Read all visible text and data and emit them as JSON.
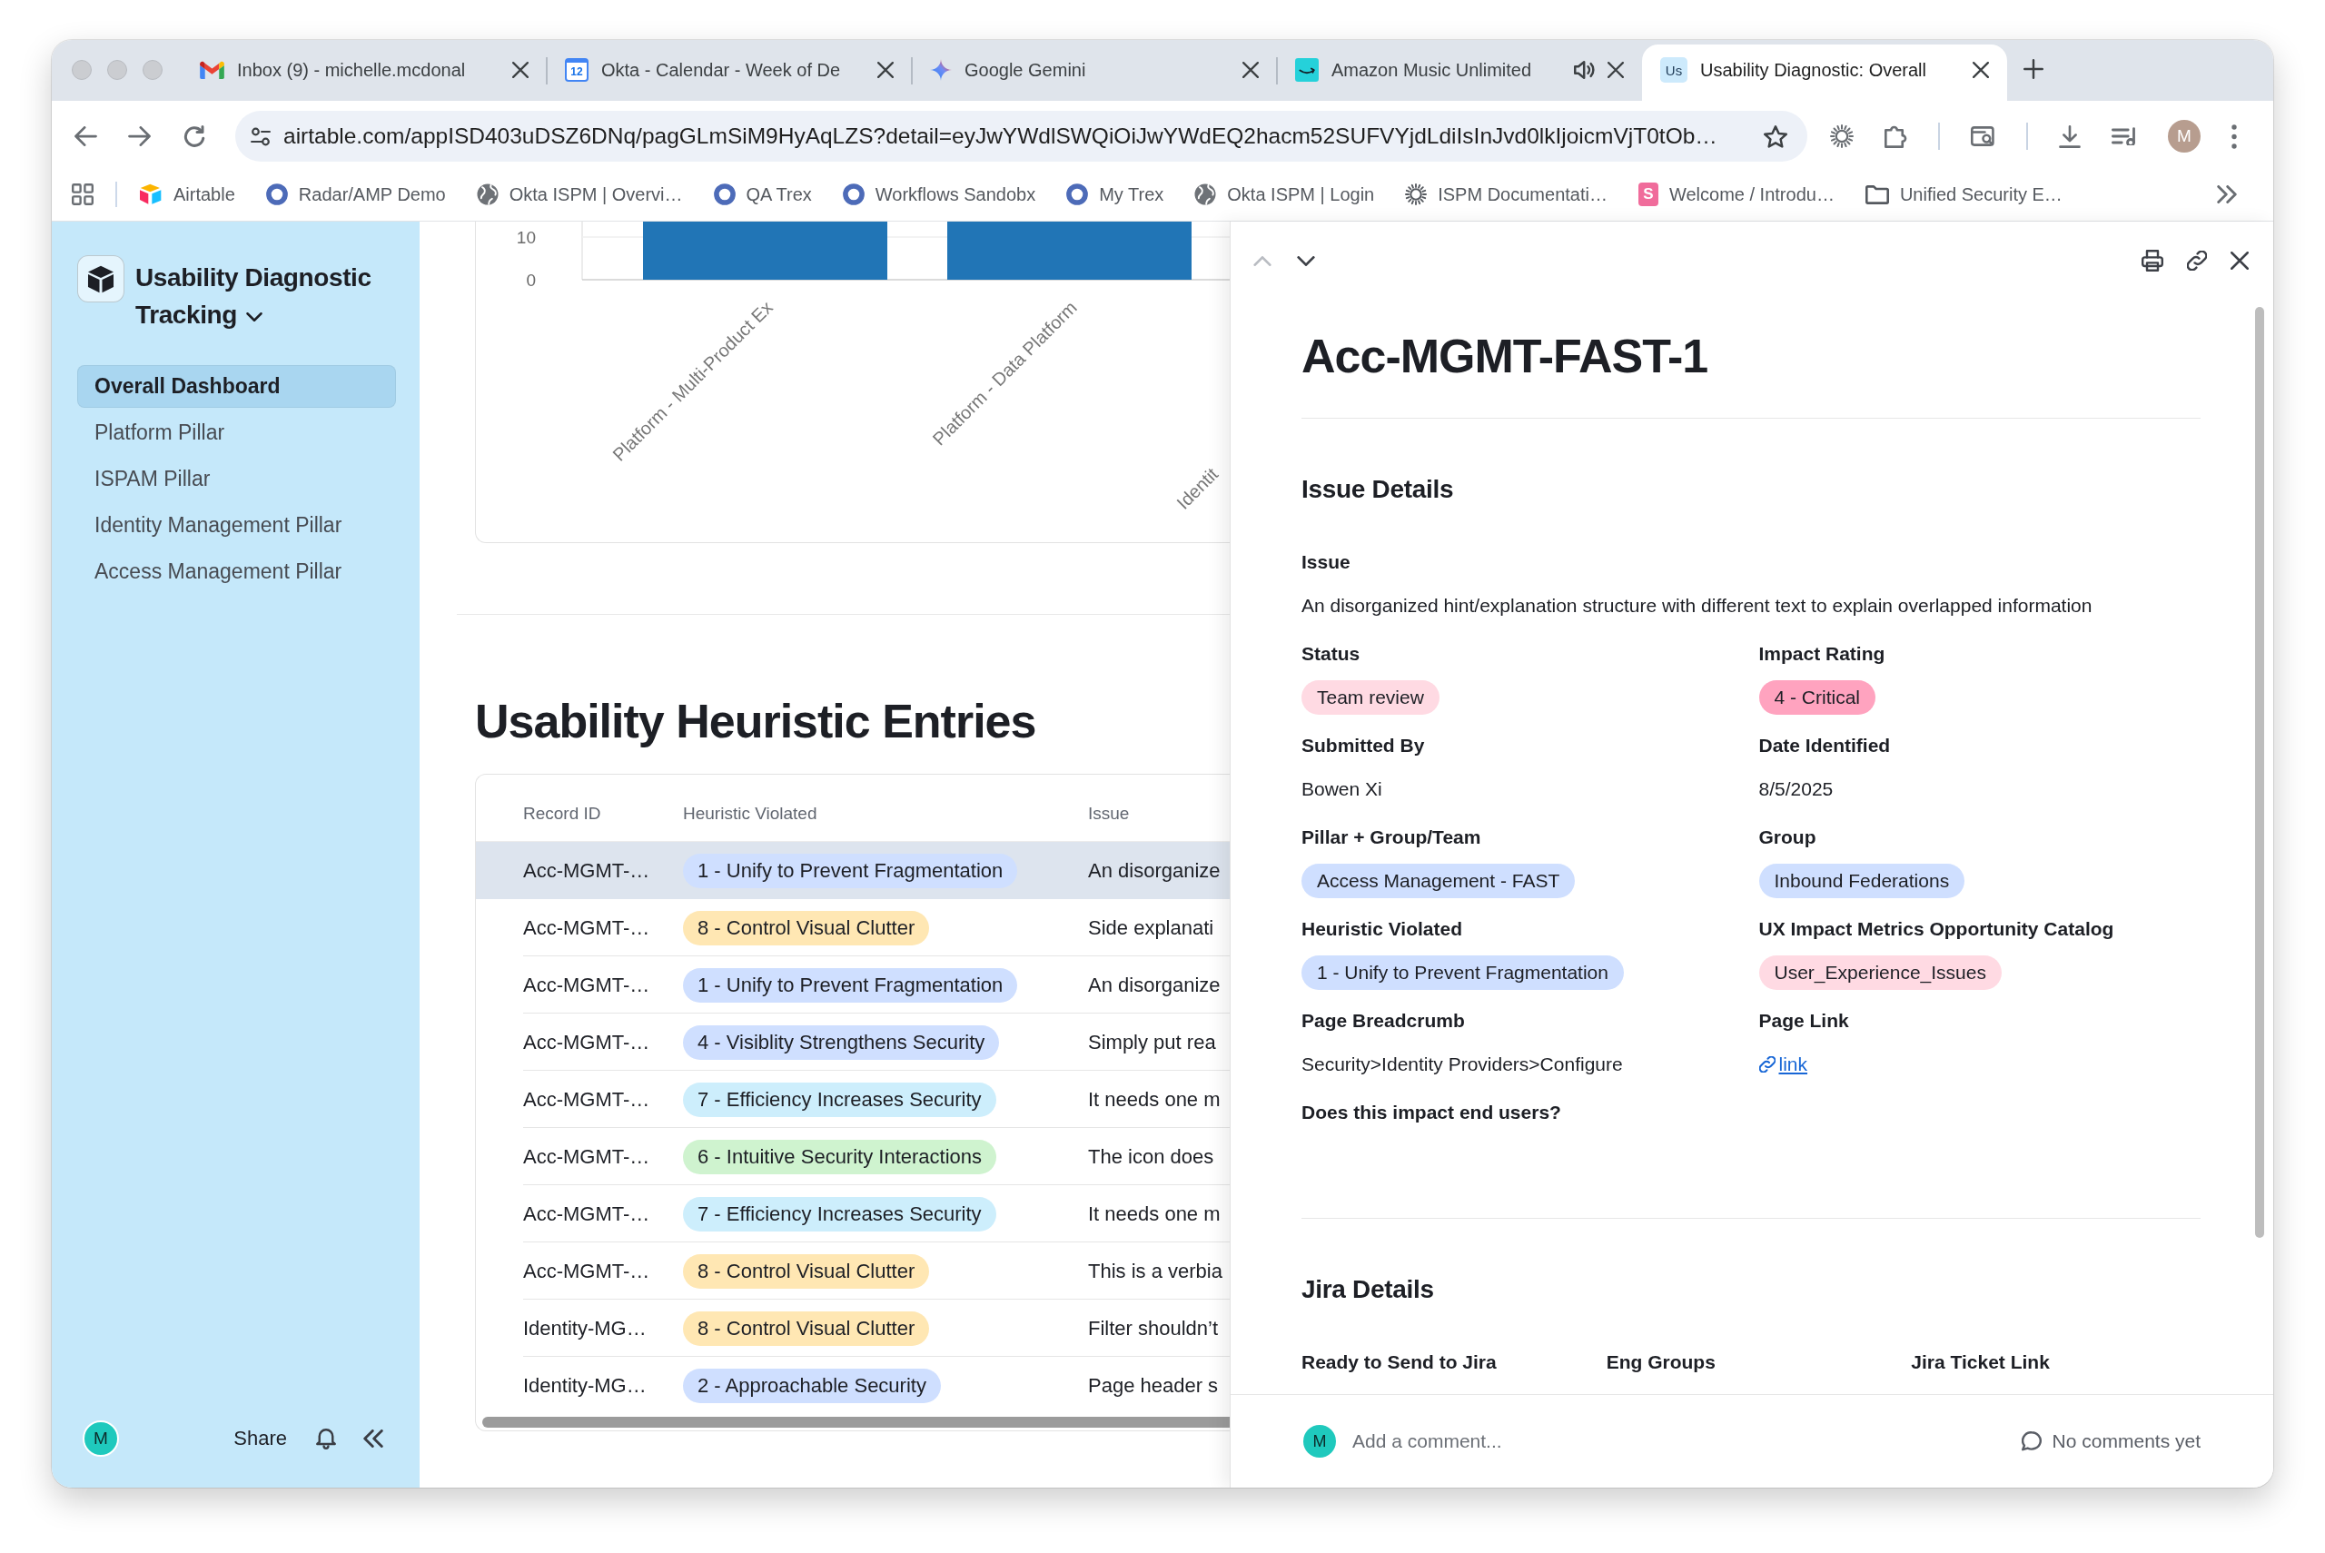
{
  "browser": {
    "tabs": [
      {
        "title": "Inbox (9) - michelle.mcdonal",
        "kind": "mail",
        "selected": false,
        "audio_playing": false
      },
      {
        "title": "Okta - Calendar - Week of De",
        "kind": "calendar",
        "favicon_text": "12",
        "selected": false,
        "audio_playing": false
      },
      {
        "title": "Google Gemini",
        "kind": "sparkle",
        "selected": false,
        "audio_playing": false
      },
      {
        "title": "Amazon Music Unlimited",
        "kind": "music",
        "selected": false,
        "audio_playing": true
      },
      {
        "title": "Usability Diagnostic: Overall",
        "kind": "letters",
        "favicon_text": "Us",
        "selected": true,
        "audio_playing": false
      }
    ],
    "url": "airtable.com/appISD403uDSZ6DNq/pagGLmSiM9HyAqLZS?detail=eyJwYWdlSWQiOiJwYWdEQ2hacm52SUFVYjdLdiIsInJvd0lkIjoicmVjT0tOb…",
    "profile_initial": "M",
    "bookmarks": [
      {
        "label": "Airtable",
        "kind": "tricolor"
      },
      {
        "label": "Radar/AMP Demo",
        "kind": "ring"
      },
      {
        "label": "Okta ISPM | Overvi…",
        "kind": "globe"
      },
      {
        "label": "QA Trex",
        "kind": "ring"
      },
      {
        "label": "Workflows Sandobx",
        "kind": "ring"
      },
      {
        "label": "My Trex",
        "kind": "ring"
      },
      {
        "label": "Okta ISPM | Login",
        "kind": "globe"
      },
      {
        "label": "ISPM Documentati…",
        "kind": "sun"
      },
      {
        "label": "Welcome / Introdu…",
        "kind": "letter",
        "icon_text": "S"
      },
      {
        "label": "Unified Security E…",
        "kind": "folder"
      }
    ]
  },
  "sidebar": {
    "title": "Usability Diagnostic Tracking",
    "items": [
      {
        "label": "Overall Dashboard",
        "selected": true
      },
      {
        "label": "Platform Pillar",
        "selected": false
      },
      {
        "label": "ISPAM Pillar",
        "selected": false
      },
      {
        "label": "Identity Management Pillar",
        "selected": false
      },
      {
        "label": "Access Management Pillar",
        "selected": false
      }
    ],
    "user_initial": "M",
    "share_label": "Share"
  },
  "chart": {
    "y_tick_labels": [
      "10",
      "0"
    ],
    "x_labels": [
      "Platform - Multi-Product Ex",
      "Platform - Data Platform",
      "Identit"
    ]
  },
  "section_title": "Usability Heuristic Entries",
  "table": {
    "columns": [
      "Record ID",
      "Heuristic Violated",
      "Issue"
    ],
    "rows": [
      {
        "record_id": "Acc-MGMT-…",
        "heuristic": {
          "label": "1 - Unify to Prevent Fragmentation",
          "color": "#cfdfff"
        },
        "issue": "An disorganize",
        "selected": true
      },
      {
        "record_id": "Acc-MGMT-…",
        "heuristic": {
          "label": "8 - Control Visual Clutter",
          "color": "#ffe7b3"
        },
        "issue": "Side explanati",
        "selected": false
      },
      {
        "record_id": "Acc-MGMT-…",
        "heuristic": {
          "label": "1 - Unify to Prevent Fragmentation",
          "color": "#cfdfff"
        },
        "issue": "An disorganize",
        "selected": false
      },
      {
        "record_id": "Acc-MGMT-…",
        "heuristic": {
          "label": "4 - Visiblity Strengthens Security",
          "color": "#cfdfff"
        },
        "issue": "Simply put rea",
        "selected": false
      },
      {
        "record_id": "Acc-MGMT-…",
        "heuristic": {
          "label": "7 - Efficiency Increases Security",
          "color": "#cdeefc"
        },
        "issue": "It needs one m",
        "selected": false
      },
      {
        "record_id": "Acc-MGMT-…",
        "heuristic": {
          "label": "6 - Intuitive Security Interactions",
          "color": "#cff3cf"
        },
        "issue": "The icon does",
        "selected": false
      },
      {
        "record_id": "Acc-MGMT-…",
        "heuristic": {
          "label": "7 - Efficiency Increases Security",
          "color": "#cdeefc"
        },
        "issue": "It needs one m",
        "selected": false
      },
      {
        "record_id": "Acc-MGMT-…",
        "heuristic": {
          "label": "8 - Control Visual Clutter",
          "color": "#ffe7b3"
        },
        "issue": "This is a verbia",
        "selected": false
      },
      {
        "record_id": "Identity-MG…",
        "heuristic": {
          "label": "8 - Control Visual Clutter",
          "color": "#ffe7b3"
        },
        "issue": "Filter shouldn’t",
        "selected": false
      },
      {
        "record_id": "Identity-MG…",
        "heuristic": {
          "label": "2 - Approachable Security",
          "color": "#cfdfff"
        },
        "issue": "Page header s",
        "selected": false
      }
    ]
  },
  "detail": {
    "nav": [
      {
        "kind": "previous",
        "disabled": true
      },
      {
        "kind": "next",
        "disabled": false
      }
    ],
    "title": "Acc-MGMT-FAST-1",
    "sections": [
      {
        "title": "Issue Details",
        "rows": [
          [
            {
              "label": "Issue",
              "kind": "text",
              "value": "An disorganized hint/explanation structure with different text to explain overlapped information"
            }
          ],
          [
            {
              "label": "Status",
              "kind": "tag",
              "value": "Team review",
              "color": "#ffdae3"
            },
            {
              "label": "Impact Rating",
              "kind": "tag",
              "value": "4 - Critical",
              "color": "#ffa3bf"
            }
          ],
          [
            {
              "label": "Submitted By",
              "kind": "text",
              "value": "Bowen Xi"
            },
            {
              "label": "Date Identified",
              "kind": "text",
              "value": "8/5/2025"
            }
          ],
          [
            {
              "label": "Pillar + Group/Team",
              "kind": "tag",
              "value": "Access Management - FAST",
              "color": "#cfdfff"
            },
            {
              "label": "Group",
              "kind": "tag",
              "value": "Inbound Federations",
              "color": "#cfdfff"
            }
          ],
          [
            {
              "label": "Heuristic Violated",
              "kind": "tag",
              "value": "1 - Unify to Prevent Fragmentation",
              "color": "#cfdfff"
            },
            {
              "label": "UX Impact Metrics Opportunity Catalog",
              "kind": "tag",
              "value": "User_Experience_Issues",
              "color": "#ffdae3"
            }
          ],
          [
            {
              "label": "Page Breadcrumb",
              "kind": "text",
              "value": "Security>Identity Providers>Configure"
            },
            {
              "label": "Page Link",
              "kind": "link",
              "value": "link"
            }
          ],
          [
            {
              "label": "Does this impact end users?",
              "kind": "empty"
            }
          ]
        ]
      },
      {
        "title": "Jira Details",
        "rows": [
          [
            {
              "label": "Ready to Send to Jira",
              "kind": "empty"
            },
            {
              "label": "Eng Groups",
              "kind": "empty"
            },
            {
              "label": "Jira Ticket Link",
              "kind": "empty"
            }
          ]
        ]
      }
    ],
    "comment_avatar_initial": "M",
    "comment_placeholder": "Add a comment...",
    "comments_status": "No comments yet"
  }
}
